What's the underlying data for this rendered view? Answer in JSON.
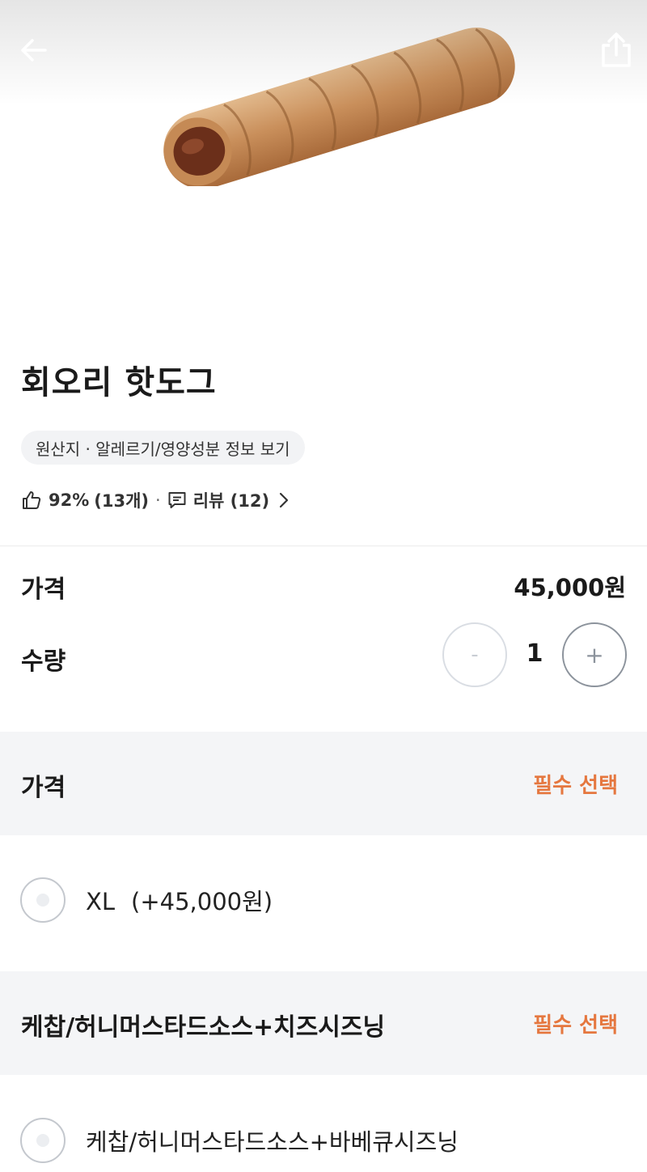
{
  "header": {
    "back_icon": "arrow-left-icon",
    "share_icon": "share-icon"
  },
  "product": {
    "name": "회오리 핫도그",
    "info_link": "원산지 · 알레르기/영양성분 정보 보기",
    "rating_percent": "92%",
    "rating_count": "(13개)",
    "separator": "·",
    "review_label": "리뷰 (12)"
  },
  "price_row": {
    "label": "가격",
    "value": "45,000원"
  },
  "quantity": {
    "label": "수량",
    "value": "1",
    "minus": "-",
    "plus": "+"
  },
  "option_groups": [
    {
      "title": "가격",
      "required_label": "필수 선택",
      "options": [
        {
          "name": "XL",
          "price": "(+45,000원)",
          "selected": false
        }
      ]
    },
    {
      "title": "케찹/허니머스타드소스+치즈시즈닝",
      "required_label": "필수 선택",
      "options": [
        {
          "name": "케찹/허니머스타드소스+바베큐시즈닝",
          "selected": false
        }
      ]
    }
  ],
  "colors": {
    "accent_required": "#e5773f",
    "section_bg": "#f4f5f7",
    "chip_bg": "#f2f3f5"
  }
}
